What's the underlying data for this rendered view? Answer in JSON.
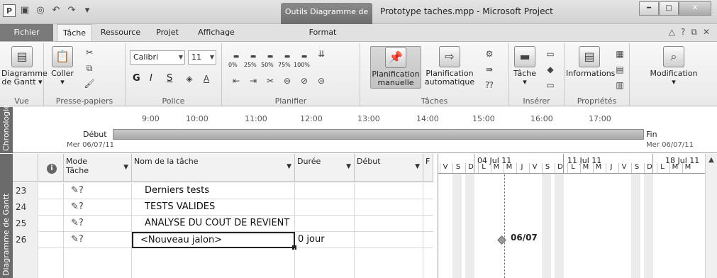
{
  "window": {
    "context_tab": "Outils Diagramme de Gantt",
    "title": "Prototype taches.mpp  -  Microsoft Project",
    "qat_icons": [
      "project-logo",
      "save",
      "circle",
      "undo",
      "redo",
      "customize"
    ]
  },
  "tabs": [
    "Fichier",
    "Tâche",
    "Ressource",
    "Projet",
    "Affichage",
    "Format"
  ],
  "ribbon": {
    "groups": {
      "vue": "Vue",
      "presse": "Presse-papiers",
      "police": "Police",
      "planifier": "Planifier",
      "taches": "Tâches",
      "inserer": "Insérer",
      "proprietes": "Propriétés"
    },
    "diagramme_l1": "Diagramme",
    "diagramme_l2": "de Gantt ▾",
    "coller_l1": "Coller",
    "coller_l2": "▾",
    "font_name": "Calibri",
    "font_size": "11",
    "bold": "G",
    "italic": "I",
    "underline": "S",
    "pct": [
      "0%",
      "25%",
      "50%",
      "75%",
      "100%"
    ],
    "plan_manuelle_l1": "Planification",
    "plan_manuelle_l2": "manuelle",
    "plan_auto_l1": "Planification",
    "plan_auto_l2": "automatique",
    "tache_l1": "Tâche",
    "tache_l2": "▾",
    "informations": "Informations",
    "modification_l1": "Modification",
    "modification_l2": "▾"
  },
  "timeline": {
    "label": "Chronologie",
    "ticks": [
      "9:00",
      "10:00",
      "11:00",
      "12:00",
      "13:00",
      "14:00",
      "15:00",
      "16:00",
      "17:00"
    ],
    "start_label": "Début",
    "start_date": "Mer 06/07/11",
    "end_label": "Fin",
    "end_date": "Mer 06/07/11"
  },
  "grid": {
    "side_label": "Diagramme de Gantt",
    "headers": {
      "info": "i",
      "mode_l1": "Mode",
      "mode_l2": "Tâche",
      "nom": "Nom de la tâche",
      "duree": "Durée",
      "debut": "Début",
      "fin": "F"
    },
    "rows": [
      {
        "id": "23",
        "name": "Derniers tests",
        "duree": ""
      },
      {
        "id": "24",
        "name": "TESTS VALIDES",
        "duree": ""
      },
      {
        "id": "25",
        "name": "ANALYSE DU COUT DE REVIENT",
        "duree": ""
      },
      {
        "id": "26",
        "name": "<Nouveau jalon>",
        "duree": "0 jour"
      }
    ]
  },
  "gantt": {
    "weeks": [
      "04 Jul 11",
      "11 Jul 11",
      "18 Jul 11"
    ],
    "days": [
      "V",
      "S",
      "D",
      "L",
      "M",
      "M",
      "J",
      "V",
      "S",
      "D",
      "L",
      "M",
      "M",
      "J",
      "V",
      "S",
      "D",
      "L",
      "M",
      "M"
    ],
    "milestone_label": "06/07"
  }
}
